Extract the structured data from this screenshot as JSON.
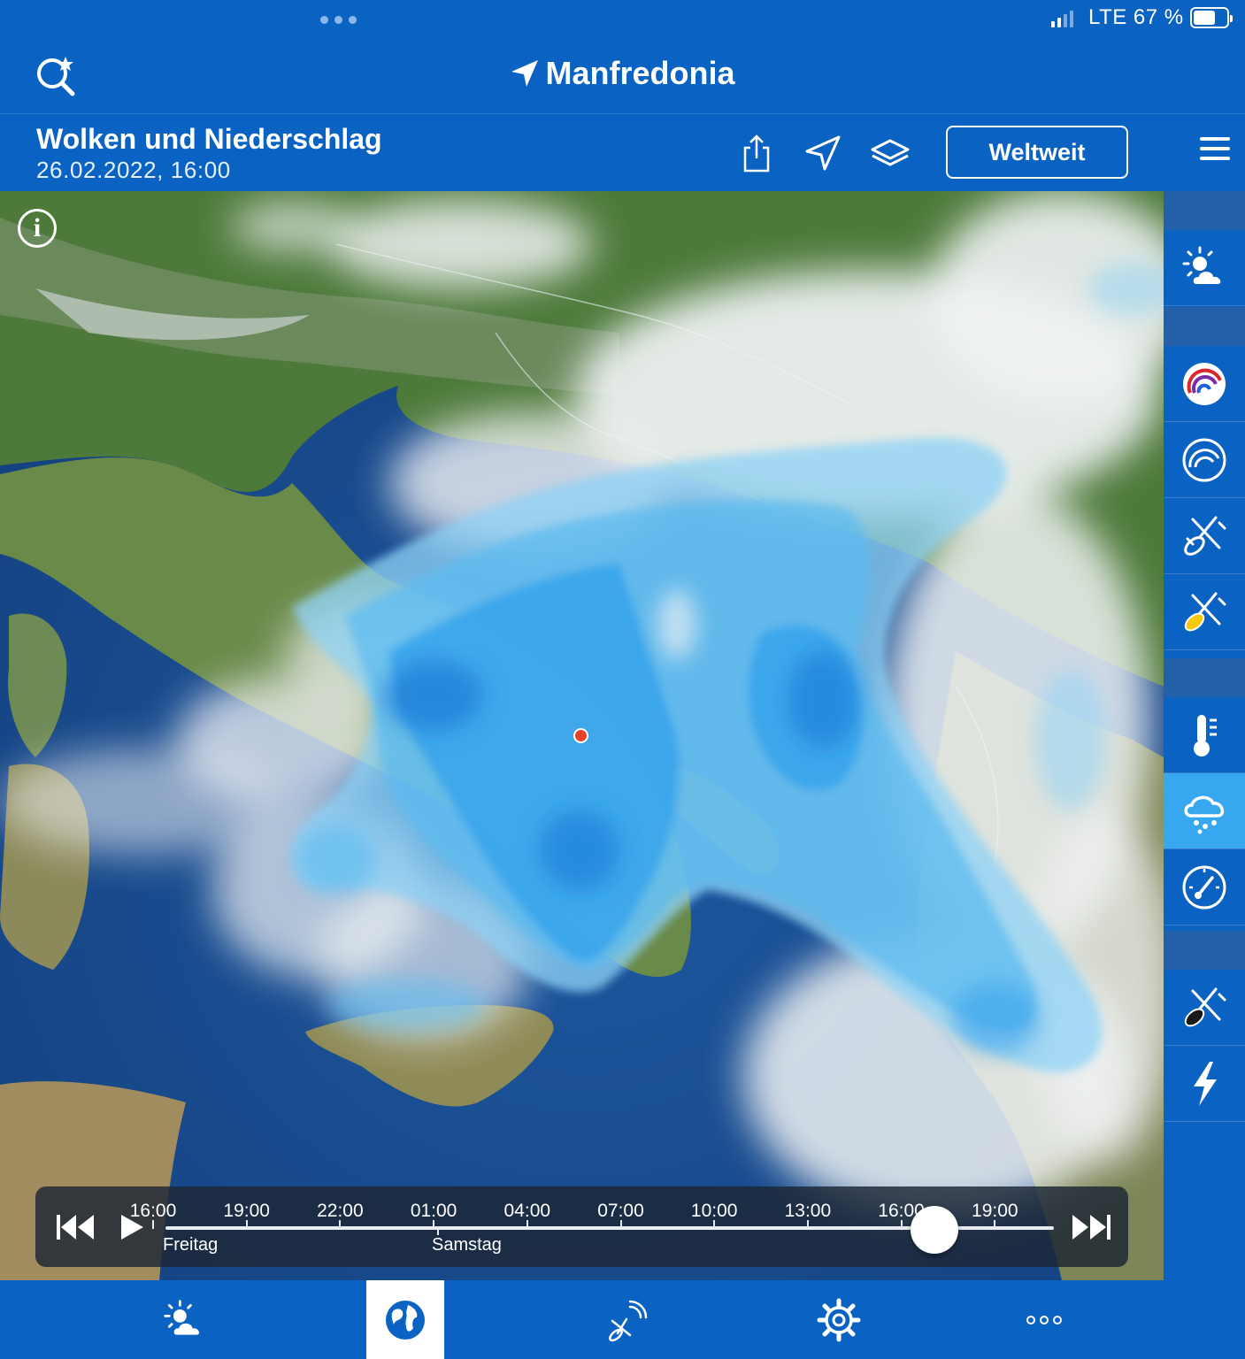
{
  "status_bar": {
    "network": "LTE",
    "battery": "67 %",
    "battery_level": 0.67
  },
  "header": {
    "location": "Manfredonia",
    "icons": [
      "search-star-icon",
      "location-arrow-icon"
    ]
  },
  "toolbar": {
    "title": "Wolken und Niederschlag",
    "datetime": "26.02.2022, 16:00",
    "region_button": "Weltweit",
    "icons": [
      "share-icon",
      "locate-icon",
      "layers-icon",
      "hamburger-menu-icon"
    ]
  },
  "map": {
    "info_icon": "info-icon",
    "location_marker_color": "#e8402a"
  },
  "timeline": {
    "times": [
      "16:00",
      "19:00",
      "22:00",
      "01:00",
      "04:00",
      "07:00",
      "10:00",
      "13:00",
      "16:00",
      "19:00"
    ],
    "days": [
      "Freitag",
      "Samstag"
    ],
    "selected_fraction": 0.866,
    "icons": [
      "skip-back-icon",
      "play-icon",
      "skip-forward-icon"
    ]
  },
  "side_panel": {
    "items": [
      {
        "icon": "sun-cloud-icon",
        "active": false
      },
      {
        "icon": "radar-color-icon",
        "active": false
      },
      {
        "icon": "radar-icon",
        "active": false
      },
      {
        "icon": "satellite-icon",
        "active": false
      },
      {
        "icon": "satellite-sun-icon",
        "active": false
      },
      {
        "icon": "thermometer-icon",
        "active": false
      },
      {
        "icon": "rain-cloud-icon",
        "active": true
      },
      {
        "icon": "wind-gauge-icon",
        "active": false
      },
      {
        "icon": "satellite-night-icon",
        "active": false
      },
      {
        "icon": "lightning-icon",
        "active": false
      }
    ]
  },
  "tab_bar": {
    "tabs": [
      {
        "icon": "weather-tab-icon",
        "active": false
      },
      {
        "icon": "globe-tab-icon",
        "active": true
      },
      {
        "icon": "satellite-radar-tab-icon",
        "active": false
      },
      {
        "icon": "settings-gear-icon",
        "active": false
      },
      {
        "icon": "more-dots-icon",
        "active": false
      }
    ]
  },
  "colors": {
    "brand_blue": "#0a63c2",
    "active_side_item": "#37a7ef",
    "precip_light": "#8fd2f6",
    "precip_dark": "#1f7fd8"
  }
}
